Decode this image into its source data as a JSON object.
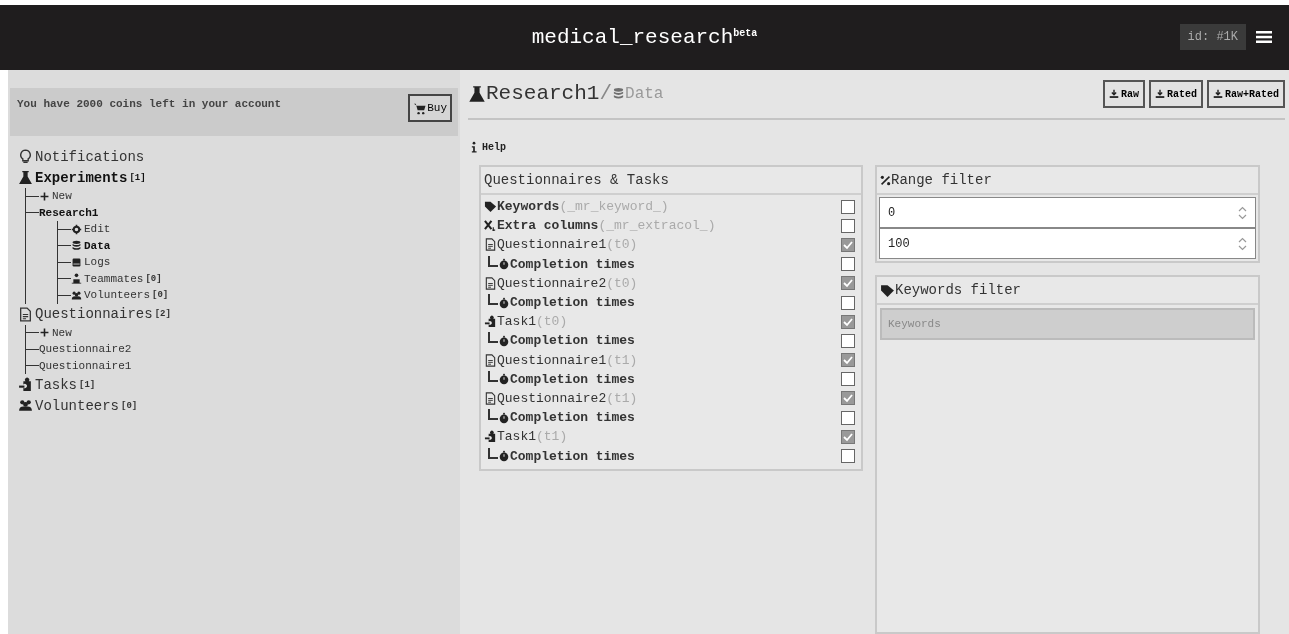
{
  "header": {
    "title": "medical_research",
    "badge": "beta",
    "id_label": "id: #1K"
  },
  "sidebar": {
    "coins_text": "You have 2000 coins left in your account",
    "buy_button": "Buy",
    "items": [
      {
        "kind": "bulb",
        "label": "Notifications",
        "selected": false
      },
      {
        "kind": "flask",
        "label": "Experiments",
        "count": "[1]",
        "selected": true,
        "children": [
          {
            "kind": "plus",
            "label": "New",
            "selected": false
          },
          {
            "kind": "none",
            "label": "Research1",
            "selected": true,
            "children": [
              {
                "kind": "gear",
                "label": "Edit",
                "selected": false
              },
              {
                "kind": "database",
                "label": "Data",
                "selected": true
              },
              {
                "kind": "book",
                "label": "Logs",
                "selected": false
              },
              {
                "kind": "person",
                "label": "Teammates",
                "count": "[0]",
                "selected": false
              },
              {
                "kind": "group",
                "label": "Volunteers",
                "count": "[0]",
                "selected": false
              }
            ]
          }
        ]
      },
      {
        "kind": "file",
        "label": "Questionnaires",
        "count": "[2]",
        "selected": false,
        "children": [
          {
            "kind": "plus",
            "label": "New",
            "selected": false
          },
          {
            "kind": "none",
            "label": "Questionnaire2",
            "selected": false
          },
          {
            "kind": "none",
            "label": "Questionnaire1",
            "selected": false
          }
        ]
      },
      {
        "kind": "puzzle",
        "label": "Tasks",
        "count": "[1]",
        "selected": false
      },
      {
        "kind": "group",
        "label": "Volunteers",
        "count": "[0]",
        "selected": false
      }
    ]
  },
  "breadcrumb": {
    "experiment": "Research1",
    "separator": "/",
    "page": "Data"
  },
  "downloads": [
    "Raw",
    "Rated",
    "Raw+Rated"
  ],
  "help": "Help",
  "questionnaires_panel": {
    "title": "Questionnaires & Tasks",
    "rows": [
      {
        "kind": "tag",
        "label": "Keywords",
        "suffix": "(_mr_keyword_)",
        "checked": false
      },
      {
        "kind": "columns",
        "label": "Extra columns",
        "suffix": "(_mr_extracol_)",
        "checked": false
      },
      {
        "kind": "file",
        "label": "Questionnaire1",
        "suffix": "(t0)",
        "checked": true,
        "children": [
          {
            "label": "Completion times",
            "checked": false
          }
        ]
      },
      {
        "kind": "file",
        "label": "Questionnaire2",
        "suffix": "(t0)",
        "checked": true,
        "children": [
          {
            "label": "Completion times",
            "checked": false
          }
        ]
      },
      {
        "kind": "puzzle",
        "label": "Task1",
        "suffix": "(t0)",
        "checked": true,
        "children": [
          {
            "label": "Completion times",
            "checked": false
          }
        ]
      },
      {
        "kind": "file",
        "label": "Questionnaire1",
        "suffix": "(t1)",
        "checked": true,
        "children": [
          {
            "label": "Completion times",
            "checked": false
          }
        ]
      },
      {
        "kind": "file",
        "label": "Questionnaire2",
        "suffix": "(t1)",
        "checked": true,
        "children": [
          {
            "label": "Completion times",
            "checked": false
          }
        ]
      },
      {
        "kind": "puzzle",
        "label": "Task1",
        "suffix": "(t1)",
        "checked": true,
        "children": [
          {
            "label": "Completion times",
            "checked": false
          }
        ]
      }
    ]
  },
  "range_filter": {
    "title": "Range filter",
    "min": "0",
    "max": "100"
  },
  "keywords_filter": {
    "title": "Keywords filter",
    "placeholder": "Keywords"
  }
}
